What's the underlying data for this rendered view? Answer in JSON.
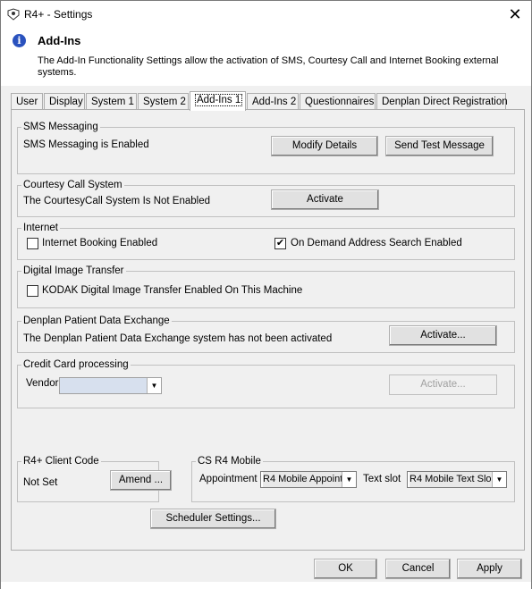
{
  "window": {
    "title": "R4+ - Settings",
    "close_glyph": "✕"
  },
  "header": {
    "title": "Add-Ins",
    "description": "The Add-In Functionality Settings allow the activation of SMS, Courtesy Call and Internet Booking external systems."
  },
  "tabs": [
    {
      "label": "User"
    },
    {
      "label": "Display"
    },
    {
      "label": "System 1"
    },
    {
      "label": "System 2"
    },
    {
      "label": "Add-Ins 1",
      "active": true
    },
    {
      "label": "Add-Ins 2"
    },
    {
      "label": "Questionnaires"
    },
    {
      "label": "Denplan Direct Registration"
    }
  ],
  "sms": {
    "legend": "SMS Messaging",
    "status": "SMS Messaging is Enabled",
    "modify_label": "Modify Details",
    "send_test_label": "Send Test Message"
  },
  "courtesy": {
    "legend": "Courtesy Call System",
    "status": "The CourtesyCall System Is Not Enabled",
    "activate_label": "Activate"
  },
  "internet": {
    "legend": "Internet",
    "booking_label": "Internet Booking Enabled",
    "booking_checked": false,
    "address_label": "On Demand Address Search Enabled",
    "address_checked": true,
    "check_glyph": "✔"
  },
  "digital": {
    "legend": "Digital Image Transfer",
    "kodak_label": "KODAK Digital Image Transfer Enabled On This Machine",
    "kodak_checked": false
  },
  "denplan": {
    "legend": "Denplan Patient Data Exchange",
    "status": "The Denplan Patient Data Exchange system has not been activated",
    "activate_label": "Activate..."
  },
  "credit": {
    "legend": "Credit Card processing",
    "vendor_label": "Vendor",
    "vendor_value": "",
    "activate_label": "Activate..."
  },
  "client_code": {
    "legend": "R4+ Client Code",
    "value": "Not Set",
    "amend_label": "Amend ..."
  },
  "mobile": {
    "legend": "CS R4 Mobile",
    "appointment_label": "Appointment",
    "appointment_value": "R4 Mobile Appoint",
    "text_slot_label": "Text slot",
    "text_slot_value": "R4 Mobile Text Slo"
  },
  "scheduler_label": "Scheduler Settings...",
  "footer": {
    "ok_label": "OK",
    "cancel_label": "Cancel",
    "apply_label": "Apply"
  },
  "icons": {
    "app": "app-icon",
    "info": "info-icon",
    "close": "close-icon",
    "dropdown": "chevron-down-icon"
  },
  "colors": {
    "info_blue": "#2a52be",
    "window_bg": "#f0f0f0"
  }
}
